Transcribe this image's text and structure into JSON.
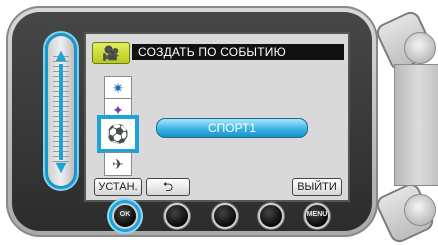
{
  "screen": {
    "header": {
      "mode_icon": "video-camera-icon",
      "title": "СОЗДАТЬ ПО СОБЫТИЮ"
    },
    "event_icons": [
      "fireworks-icon",
      "party-icon",
      "sports-icon",
      "travel-icon"
    ],
    "selected_event": "СПОРТ1",
    "buttons": {
      "set": "УСТАН.",
      "back_icon": "return-arrow-icon",
      "exit": "ВЫЙТИ"
    }
  },
  "hardware": {
    "ok_label": "OK",
    "menu_label": "MENU"
  },
  "colors": {
    "highlight": "#1ea2d8",
    "pill": "#3ab4e6",
    "header_bar": "#111111",
    "mode_badge": "#c9dc2b"
  }
}
